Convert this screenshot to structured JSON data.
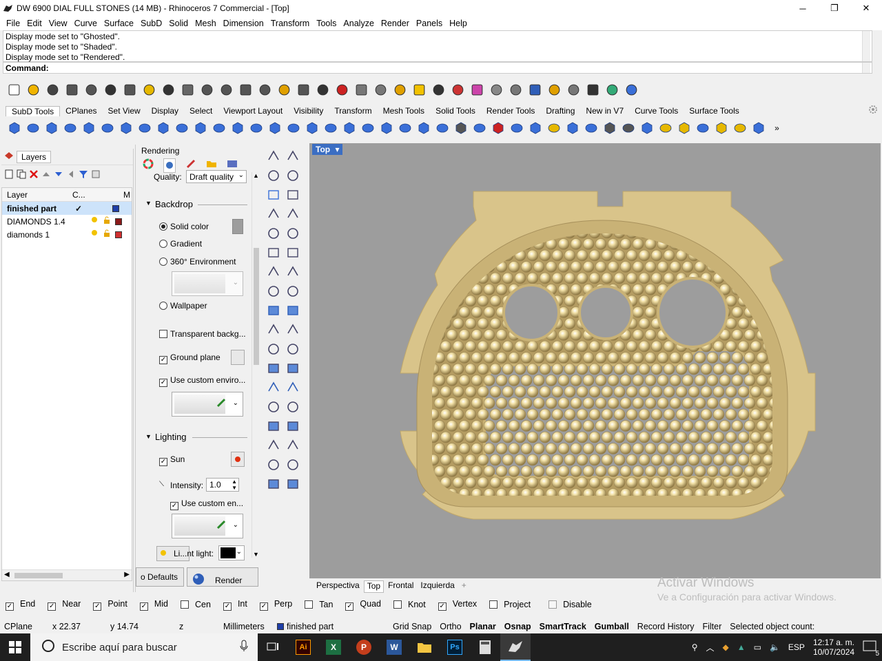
{
  "window": {
    "title": "DW 6900 DIAL FULL STONES (14 MB) - Rhinoceros 7 Commercial - [Top]",
    "minimize": "─",
    "restore": "❐",
    "close": "✕"
  },
  "menu": [
    "File",
    "Edit",
    "View",
    "Curve",
    "Surface",
    "SubD",
    "Solid",
    "Mesh",
    "Dimension",
    "Transform",
    "Tools",
    "Analyze",
    "Render",
    "Panels",
    "Help"
  ],
  "command_history": [
    "Display mode set to \"Ghosted\".",
    "Display mode set to \"Shaded\".",
    "Display mode set to \"Rendered\"."
  ],
  "command_prompt": "Command:",
  "toolbar_tabs": [
    "SubD Tools",
    "CPlanes",
    "Set View",
    "Display",
    "Select",
    "Viewport Layout",
    "Visibility",
    "Transform",
    "Mesh Tools",
    "Solid Tools",
    "Render Tools",
    "Drafting",
    "New in V7",
    "Curve Tools",
    "Surface Tools"
  ],
  "layers_panel": {
    "title": "Layers",
    "columns": [
      "Layer",
      "C...",
      "M"
    ],
    "rows": [
      {
        "name": "finished part",
        "check": "✓",
        "color": "#1f3fa8",
        "selected": true
      },
      {
        "name": "DIAMONDS 1.4",
        "color": "#8b1a1a",
        "selected": false
      },
      {
        "name": "diamonds 1",
        "color": "#d03030",
        "selected": false
      }
    ]
  },
  "rendering_panel": {
    "title": "Rendering",
    "quality_label": "Quality:",
    "quality_value": "Draft quality",
    "backdrop_header": "Backdrop",
    "solid_color": "Solid color",
    "gradient": "Gradient",
    "environment": "360° Environment",
    "wallpaper": "Wallpaper",
    "transparent": "Transparent backg...",
    "ground_plane": "Ground plane",
    "custom_env": "Use custom enviro...",
    "lighting_header": "Lighting",
    "sun": "Sun",
    "intensity_label": "Intensity:",
    "intensity_value": "1.0",
    "custom_en": "Use custom en...",
    "light_label": "Li...nt light:",
    "defaults_button": "o Defaults",
    "render_button": "Render"
  },
  "viewport": {
    "active_name": "Top",
    "tabs": [
      "Perspectiva",
      "Top",
      "Frontal",
      "Izquierda"
    ],
    "add_tab": "+",
    "colors": {
      "background": "#9d9d9d",
      "part": "#d9c48a",
      "part_dark": "#bfa76b"
    }
  },
  "watermark": {
    "line1": "Activar Windows",
    "line2": "Ve a Configuración para activar Windows."
  },
  "osnaps": [
    {
      "label": "End",
      "checked": true
    },
    {
      "label": "Near",
      "checked": true
    },
    {
      "label": "Point",
      "checked": true
    },
    {
      "label": "Mid",
      "checked": true
    },
    {
      "label": "Cen",
      "checked": false
    },
    {
      "label": "Int",
      "checked": true
    },
    {
      "label": "Perp",
      "checked": true
    },
    {
      "label": "Tan",
      "checked": false
    },
    {
      "label": "Quad",
      "checked": true
    },
    {
      "label": "Knot",
      "checked": false
    },
    {
      "label": "Vertex",
      "checked": true
    },
    {
      "label": "Project",
      "checked": false
    },
    {
      "label": "Disable",
      "checked": false
    }
  ],
  "status": {
    "cplane": "CPlane",
    "x": "x 22.37",
    "y": "y 14.74",
    "z": "z",
    "units": "Millimeters",
    "layer": "finished part",
    "grid_snap": "Grid Snap",
    "ortho": "Ortho",
    "planar": "Planar",
    "osnap": "Osnap",
    "smarttrack": "SmartTrack",
    "gumball": "Gumball",
    "record_history": "Record History",
    "filter": "Filter",
    "selected_count": "Selected object count:"
  },
  "taskbar": {
    "search_placeholder": "Escribe aquí para buscar",
    "lang": "ESP",
    "time": "12:17 a. m.",
    "date": "10/07/2024",
    "notifications": "5"
  }
}
